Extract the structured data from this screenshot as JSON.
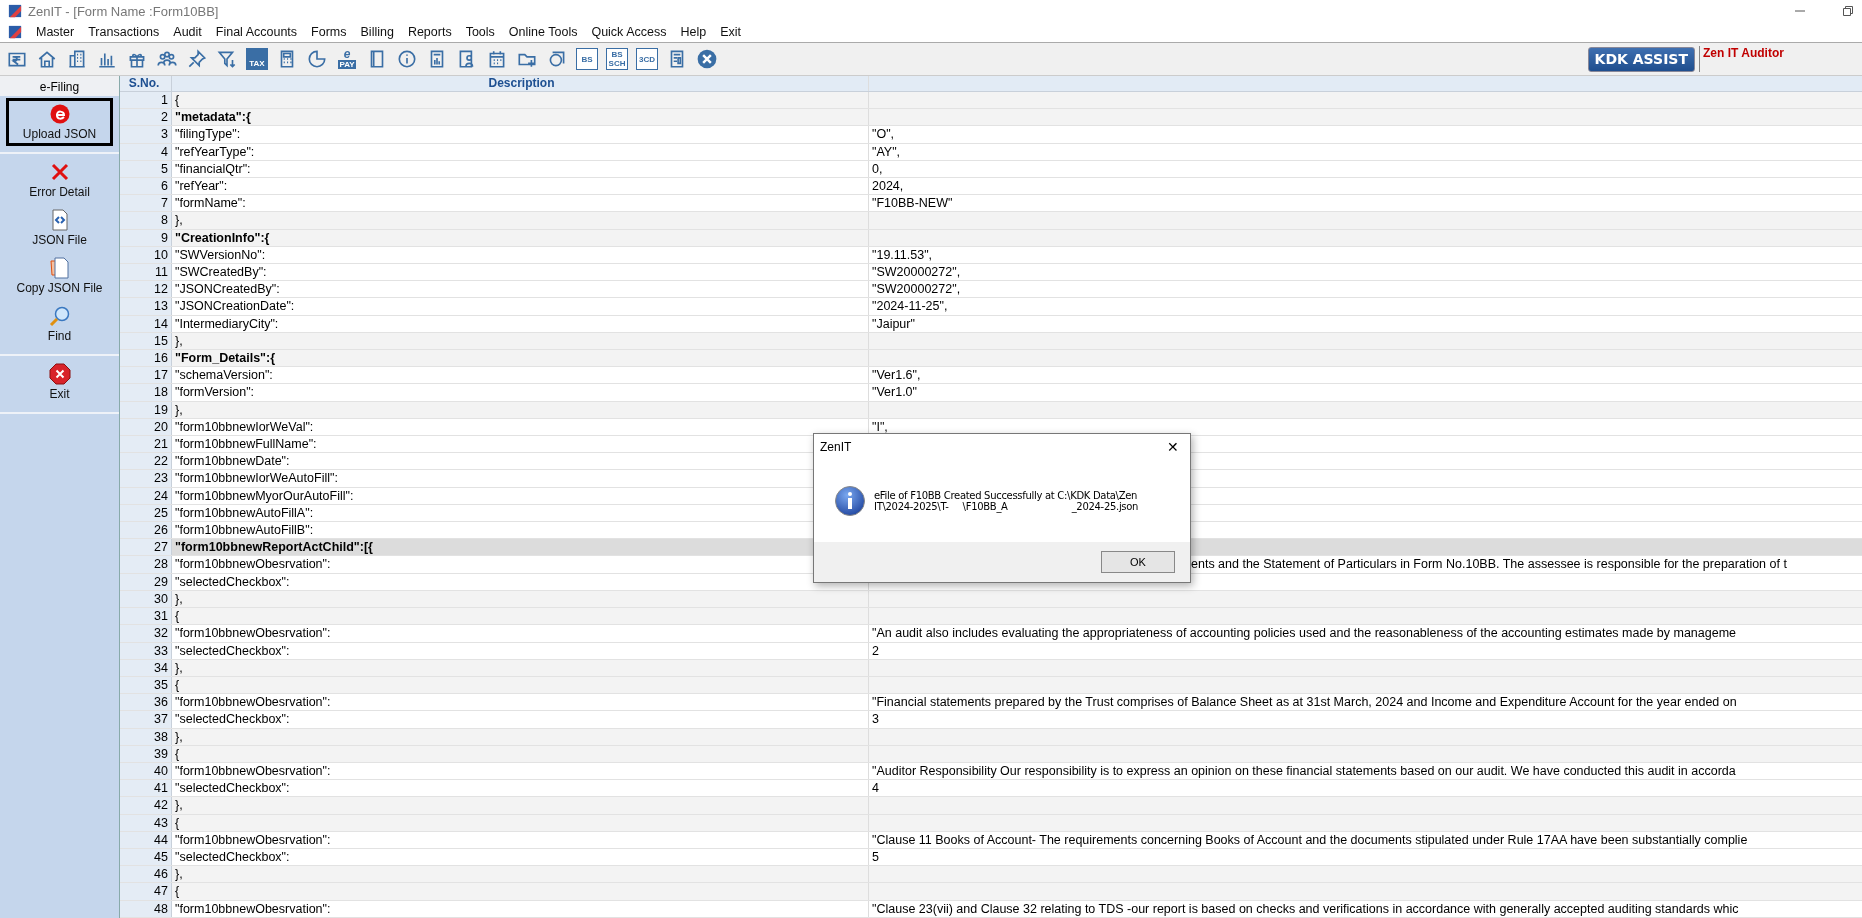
{
  "window": {
    "title": "ZenIT - [Form Name :Form10BB]"
  },
  "menu": [
    "Master",
    "Transactions",
    "Audit",
    "Final Accounts",
    "Forms",
    "Billing",
    "Reports",
    "Tools",
    "Online Tools",
    "Quick Access",
    "Help",
    "Exit"
  ],
  "toolbar": [
    {
      "kind": "rupee"
    },
    {
      "kind": "house"
    },
    {
      "kind": "building"
    },
    {
      "kind": "bars"
    },
    {
      "kind": "gift"
    },
    {
      "kind": "people"
    },
    {
      "kind": "pin"
    },
    {
      "kind": "filter"
    },
    {
      "kind": "boxtext",
      "text": [
        "TAX"
      ]
    },
    {
      "kind": "calculator"
    },
    {
      "kind": "pie"
    },
    {
      "kind": "epay",
      "text": [
        "e",
        "PAY"
      ]
    },
    {
      "kind": "book"
    },
    {
      "kind": "info"
    },
    {
      "kind": "report"
    },
    {
      "kind": "contact"
    },
    {
      "kind": "calendar"
    },
    {
      "kind": "folder"
    },
    {
      "kind": "window"
    },
    {
      "kind": "outlinetext",
      "text": [
        "BS"
      ]
    },
    {
      "kind": "outlinetext",
      "text": [
        "BS",
        "SCH"
      ]
    },
    {
      "kind": "outlinetext",
      "text": [
        "3CD"
      ]
    },
    {
      "kind": "grid"
    },
    {
      "kind": "close"
    }
  ],
  "assist": {
    "button": "KDK ASSIST",
    "label": "Zen IT Auditor"
  },
  "sidebar": {
    "title": "e-Filing",
    "groups": [
      [
        {
          "label": "Upload JSON",
          "kind": "efile",
          "selected": true
        }
      ],
      [
        {
          "label": "Error Detail",
          "kind": "cross",
          "selected": false
        },
        {
          "label": "JSON File",
          "kind": "code-file",
          "selected": false
        },
        {
          "label": "Copy JSON File",
          "kind": "copy-file",
          "selected": false
        },
        {
          "label": "Find",
          "kind": "magnifier",
          "selected": false
        }
      ],
      [
        {
          "label": "Exit",
          "kind": "stop",
          "selected": false
        }
      ]
    ]
  },
  "table": {
    "columns": [
      "S.No.",
      "Description"
    ],
    "rows": [
      {
        "n": "1",
        "kind": "brace",
        "text": "{",
        "selected": false
      },
      {
        "n": "2",
        "kind": "object",
        "text": "\"metadata\":{",
        "selected": false
      },
      {
        "n": "3",
        "kind": "field",
        "text": "\"filingType\":",
        "value": "\"O\",",
        "selected": false
      },
      {
        "n": "4",
        "kind": "field",
        "text": "\"refYearType\":",
        "value": "\"AY\",",
        "selected": false
      },
      {
        "n": "5",
        "kind": "field",
        "text": "\"financialQtr\":",
        "value": "0,",
        "selected": false
      },
      {
        "n": "6",
        "kind": "field",
        "text": "\"refYear\":",
        "value": "2024,",
        "selected": false
      },
      {
        "n": "7",
        "kind": "field",
        "text": "\"formName\":",
        "value": "\"F10BB-NEW\"",
        "selected": false
      },
      {
        "n": "8",
        "kind": "brace",
        "text": "},",
        "selected": false
      },
      {
        "n": "9",
        "kind": "object",
        "text": "\"CreationInfo\":{",
        "selected": false
      },
      {
        "n": "10",
        "kind": "field",
        "text": "\"SWVersionNo\":",
        "value": "\"19.11.53\",",
        "selected": false
      },
      {
        "n": "11",
        "kind": "field",
        "text": "\"SWCreatedBy\":",
        "value": "\"SW20000272\",",
        "selected": false
      },
      {
        "n": "12",
        "kind": "field",
        "text": "\"JSONCreatedBy\":",
        "value": "\"SW20000272\",",
        "selected": false
      },
      {
        "n": "13",
        "kind": "field",
        "text": "\"JSONCreationDate\":",
        "value": "\"2024-11-25\",",
        "selected": false
      },
      {
        "n": "14",
        "kind": "field",
        "text": "\"IntermediaryCity\":",
        "value": "\"Jaipur\"",
        "selected": false
      },
      {
        "n": "15",
        "kind": "brace",
        "text": "},",
        "selected": false
      },
      {
        "n": "16",
        "kind": "object",
        "text": "\"Form_Details\":{",
        "selected": false
      },
      {
        "n": "17",
        "kind": "field",
        "text": "\"schemaVersion\":",
        "value": "\"Ver1.6\",",
        "selected": false
      },
      {
        "n": "18",
        "kind": "field",
        "text": "\"formVersion\":",
        "value": "\"Ver1.0\"",
        "selected": false
      },
      {
        "n": "19",
        "kind": "brace",
        "text": "},",
        "selected": false
      },
      {
        "n": "20",
        "kind": "field",
        "text": "\"form10bbnewIorWeVal\":",
        "value": "\"I\",",
        "selected": false
      },
      {
        "n": "21",
        "kind": "field",
        "text": "\"form10bbnewFullName\":",
        "selected": false
      },
      {
        "n": "22",
        "kind": "field",
        "text": "\"form10bbnewDate\":",
        "selected": false
      },
      {
        "n": "23",
        "kind": "field",
        "text": "\"form10bbnewIorWeAutoFill\":",
        "selected": false
      },
      {
        "n": "24",
        "kind": "field",
        "text": "\"form10bbnewMyorOurAutoFill\":",
        "selected": false
      },
      {
        "n": "25",
        "kind": "field",
        "text": "\"form10bbnewAutoFillA\":",
        "selected": false
      },
      {
        "n": "26",
        "kind": "field",
        "text": "\"form10bbnewAutoFillB\":",
        "selected": false
      },
      {
        "n": "27",
        "kind": "object",
        "text": "\"form10bbnewReportActChild\":[{",
        "selected": true
      },
      {
        "n": "28",
        "kind": "field",
        "text": "\"form10bbnewObesrvation\":",
        "value": "ents and the Statement of Particulars in Form No.10BB. The assessee is responsible for the preparation of t",
        "covered": true,
        "selected": false
      },
      {
        "n": "29",
        "kind": "field",
        "text": "\"selectedCheckbox\":",
        "selected": false
      },
      {
        "n": "30",
        "kind": "brace",
        "text": "},",
        "selected": false
      },
      {
        "n": "31",
        "kind": "brace",
        "text": "{",
        "selected": false
      },
      {
        "n": "32",
        "kind": "field",
        "text": "\"form10bbnewObesrvation\":",
        "value": "\"An audit also includes evaluating the appropriateness of accounting policies used and the reasonableness of the accounting estimates made by manageme",
        "selected": false
      },
      {
        "n": "33",
        "kind": "field",
        "text": "\"selectedCheckbox\":",
        "value": "2",
        "selected": false
      },
      {
        "n": "34",
        "kind": "brace",
        "text": "},",
        "selected": false
      },
      {
        "n": "35",
        "kind": "brace",
        "text": "{",
        "selected": false
      },
      {
        "n": "36",
        "kind": "field",
        "text": "\"form10bbnewObesrvation\":",
        "value": "\"Financial statements prepared by the Trust comprises of Balance Sheet as at 31st March, 2024 and Income and Expenditure Account for the year ended on",
        "selected": false
      },
      {
        "n": "37",
        "kind": "field",
        "text": "\"selectedCheckbox\":",
        "value": "3",
        "selected": false
      },
      {
        "n": "38",
        "kind": "brace",
        "text": "},",
        "selected": false
      },
      {
        "n": "39",
        "kind": "brace",
        "text": "{",
        "selected": false
      },
      {
        "n": "40",
        "kind": "field",
        "text": "\"form10bbnewObesrvation\":",
        "value": "\"Auditor Responsibility Our responsibility is to express an opinion on these financial statements based on our audit. We have conducted this audit in accorda",
        "selected": false
      },
      {
        "n": "41",
        "kind": "field",
        "text": "\"selectedCheckbox\":",
        "value": "4",
        "selected": false
      },
      {
        "n": "42",
        "kind": "brace",
        "text": "},",
        "selected": false
      },
      {
        "n": "43",
        "kind": "brace",
        "text": "{",
        "selected": false
      },
      {
        "n": "44",
        "kind": "field",
        "text": "\"form10bbnewObesrvation\":",
        "value": "\"Clause 11 Books of Account- The requirements concerning Books of Account and the documents stipulated under Rule 17AA have been substantially complie",
        "selected": false
      },
      {
        "n": "45",
        "kind": "field",
        "text": "\"selectedCheckbox\":",
        "value": "5",
        "selected": false
      },
      {
        "n": "46",
        "kind": "brace",
        "text": "},",
        "selected": false
      },
      {
        "n": "47",
        "kind": "brace",
        "text": "{",
        "selected": false
      },
      {
        "n": "48",
        "kind": "field",
        "text": "\"form10bbnewObesrvation\":",
        "value": "\"Clause 23(vii) and Clause 32 relating to TDS -our report is based on checks and verifications in accordance with generally accepted auditing standards whic",
        "selected": false
      }
    ]
  },
  "dialog": {
    "title": "ZenIT",
    "close": "✕",
    "lines": [
      [
        "eFile of F10BB Created Successfully at C:\\KDK Data\\Zen"
      ],
      [
        "IT\\2024-2025\\T-",
        "\\F10BB_A",
        "_2024-25.json"
      ]
    ],
    "button": "OK"
  }
}
